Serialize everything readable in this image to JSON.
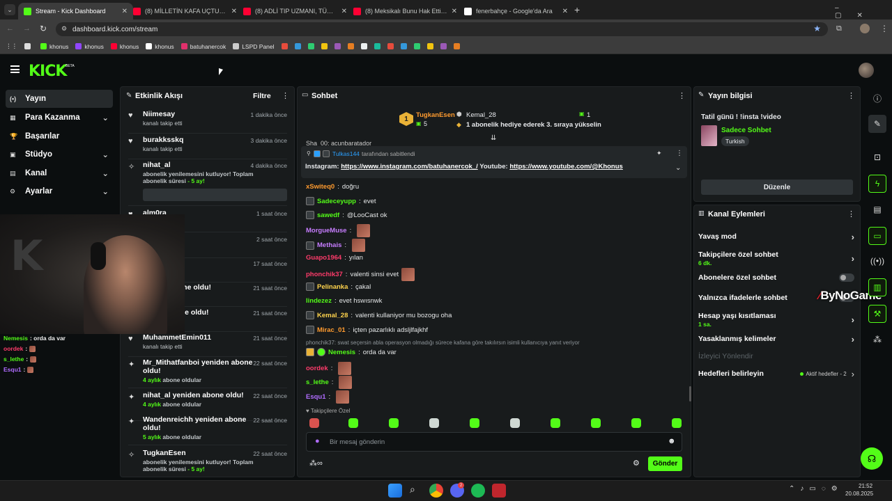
{
  "browser": {
    "tabs": [
      {
        "label": "Stream - Kick Dashboard",
        "color": "#53fc18"
      },
      {
        "label": "(8) MİLLETİN KAFA UÇTU 5Srid…",
        "color": "#ff0033"
      },
      {
        "label": "(8) ADLİ TIP UZMANI, TÜRK DÜ…",
        "color": "#ff0033"
      },
      {
        "label": "(8) Meksikalı Bunu Hak Etti mi?",
        "color": "#ff0033"
      },
      {
        "label": "fenerbahçe - Google'da Ara",
        "color": "#ffffff"
      }
    ],
    "url": "dashboard.kick.com/stream",
    "bookmarks": [
      {
        "label": "",
        "color": "#ddd"
      },
      {
        "label": "khonus",
        "color": "#53fc18"
      },
      {
        "label": "khonus",
        "color": "#9146ff"
      },
      {
        "label": "khonus",
        "color": "#ff0033"
      },
      {
        "label": "khonus",
        "color": "#ffffff"
      },
      {
        "label": "batuhanercok",
        "color": "#e1306c"
      },
      {
        "label": "LSPD Panel",
        "color": "#cccccc"
      }
    ]
  },
  "header": {
    "logo": "KICK",
    "beta": "BETA"
  },
  "nav": [
    {
      "label": "Yayın",
      "icon": "(•)",
      "chev": ""
    },
    {
      "label": "Para Kazanma",
      "icon": "▦",
      "chev": "⌄"
    },
    {
      "label": "Başarılar",
      "icon": "🏆",
      "chev": ""
    },
    {
      "label": "Stüdyo",
      "icon": "▣",
      "chev": "⌄"
    },
    {
      "label": "Kanal",
      "icon": "▤",
      "chev": "⌄"
    },
    {
      "label": "Ayarlar",
      "icon": "⚙",
      "chev": "⌄"
    }
  ],
  "activity": {
    "title": "Etkinlik Akışı",
    "filter": "Filtre",
    "events": [
      {
        "name": "Niimesay",
        "sub": "kanalı takip etti",
        "time": "1 dakika önce",
        "icon": "♥"
      },
      {
        "name": "burakksskq",
        "sub": "kanalı takip etti",
        "time": "3 dakika önce",
        "icon": "♥"
      },
      {
        "name": "nihat_al",
        "sub": "abonelik yenilemesini kutluyor! Toplam abonelik süresi - 5 ay!",
        "time": "4 dakika önce",
        "icon": "✧"
      },
      {
        "name": "alm0ra",
        "sub": "kanalı takip etti",
        "time": "1 saat önce",
        "icon": "♥"
      },
      {
        "name": "",
        "sub": "",
        "time": "2 saat önce",
        "icon": ""
      },
      {
        "name": "",
        "sub": "",
        "time": "17 saat önce",
        "icon": ""
      },
      {
        "name": "…nden abone oldu!",
        "sub": "…lar",
        "time": "21 saat önce",
        "icon": ""
      },
      {
        "name": "…iden abone oldu!",
        "sub": "…ldular",
        "time": "21 saat önce",
        "icon": ""
      },
      {
        "name": "MuhammetEmin011",
        "sub": "kanalı takip etti",
        "time": "21 saat önce",
        "icon": "♥"
      },
      {
        "name": "Mr_Mithatfanboi yeniden abone oldu!",
        "sub": "4 aylık abone oldular",
        "time": "22 saat önce",
        "icon": "✦"
      },
      {
        "name": "nihat_al yeniden abone oldu!",
        "sub": "4 aylık abone oldular",
        "time": "22 saat önce",
        "icon": "✦"
      },
      {
        "name": "Wandenreichh yeniden abone oldu!",
        "sub": "5 aylık abone oldular",
        "time": "22 saat önce",
        "icon": "✦"
      },
      {
        "name": "TugkanEsen",
        "sub": "abonelik yenilemesini kutluyor! Toplam abonelik süresi - 5 ay!",
        "time": "22 saat önce",
        "icon": "✧"
      }
    ]
  },
  "overlay_chat": [
    {
      "user": "Nemesis",
      "msg": ": orda da var",
      "color": "#53fc18"
    },
    {
      "user": "oordek",
      "msg": ":",
      "color": "#ff3b6b"
    },
    {
      "user": "s_lethe",
      "msg": ":",
      "color": "#53fc18"
    },
    {
      "user": "Esqu1",
      "msg": ":",
      "color": "#b06cff"
    }
  ],
  "chat": {
    "title": "Sohbet",
    "leaderboard": {
      "rank": "1",
      "user1": "TugkanEsen",
      "count1": "5",
      "user2": "Kemal_28",
      "count2": "1",
      "gift_msg": "1 abonelik hediye ederek 3. sıraya yükselin"
    },
    "pinned": {
      "by": "Tulkas144",
      "by_suffix": "tarafından sabitlendi",
      "text": "Instagram: ",
      "link1": "https://www.instagram.com/batuhanercok_/",
      "mid": " Youtube: ",
      "link2": "https://www.youtube.com/@Khonus"
    },
    "partial_top": "Sha_00: acunbaratador",
    "messages": [
      {
        "user": "xSwiteq0",
        "color": "#ff9b2f",
        "msg": "doğru",
        "badge": false,
        "emote": false
      },
      {
        "user": "Sadeceyupp",
        "color": "#53fc18",
        "msg": "evet",
        "badge": true,
        "emote": false
      },
      {
        "user": "sawedf",
        "color": "#53fc18",
        "msg": "@LooCast ok",
        "badge": true,
        "emote": false
      },
      {
        "user": "MorgueMuse",
        "color": "#c77dff",
        "msg": "",
        "badge": false,
        "emote": true
      },
      {
        "user": "Methais",
        "color": "#c77dff",
        "msg": "",
        "badge": true,
        "emote": true
      },
      {
        "user": "Guapo1964",
        "color": "#ff3b6b",
        "msg": "yılan",
        "badge": false,
        "emote": false
      },
      {
        "user": "phonchik37",
        "color": "#ff3b6b",
        "msg": "valenti sinsi evet",
        "badge": false,
        "emote": true
      },
      {
        "user": "Pelinanka",
        "color": "#ffd34d",
        "msg": "çakal",
        "badge": true,
        "emote": false
      },
      {
        "user": "lindezez",
        "color": "#53fc18",
        "msg": "evet hswısnwk",
        "badge": false,
        "emote": false
      },
      {
        "user": "Kemal_28",
        "color": "#ffd34d",
        "msg": "valenti kullaniyor mu bozogu oha",
        "badge": true,
        "emote": false
      },
      {
        "user": "Mirac_01",
        "color": "#ff9b2f",
        "msg": "içten pazarlıklı adsljlfajkhf",
        "badge": true,
        "emote": false
      }
    ],
    "reply_context": "phonchik37: swat seçersin abla operasyon olmadığı sürece kafana göre takılırsın isimli kullanıcıya yanıt veriyor",
    "messages2": [
      {
        "user": "Nemesis",
        "color": "#53fc18",
        "msg": "orda da var"
      },
      {
        "user": "oordek",
        "color": "#ff3b6b",
        "msg": ""
      },
      {
        "user": "s_lethe",
        "color": "#53fc18",
        "msg": ""
      },
      {
        "user": "Esqu1",
        "color": "#b06cff",
        "msg": ""
      }
    ],
    "followers_only": "Takipçilere Özel",
    "placeholder": "Bir mesaj gönderin",
    "send": "Gönder"
  },
  "stream_info": {
    "title": "Yayın bilgisi",
    "stream_title": "Tatil günü ! !insta !video",
    "category": "Sadece Sohbet",
    "tag": "Turkish",
    "edit": "Düzenle"
  },
  "channel_actions": {
    "title": "Kanal Eylemleri",
    "rows": [
      {
        "label": "Yavaş mod",
        "sub": "",
        "kind": "chev"
      },
      {
        "label": "Takipçilere özel sohbet",
        "sub": "6 dk.",
        "kind": "chev"
      },
      {
        "label": "Abonelere özel sohbet",
        "sub": "",
        "kind": "toggle"
      },
      {
        "label": "Yalnızca ifadelerle sohbet",
        "sub": "",
        "kind": "toggle"
      },
      {
        "label": "Hesap yaşı kısıtlaması",
        "sub": "1 sa.",
        "kind": "chev"
      },
      {
        "label": "Yasaklanmış kelimeler",
        "sub": "",
        "kind": "chev"
      },
      {
        "label": "İzleyici Yönlendir",
        "sub": "",
        "kind": "disabled"
      },
      {
        "label": "Hedefleri belirleyin",
        "sub": "",
        "kind": "goal",
        "extra": "Aktif hedefler - 2"
      }
    ]
  },
  "watermark": "ByNoGame",
  "taskbar": {
    "time": "21:52",
    "date": "20.08.2025",
    "badge": "2"
  },
  "colors": {
    "accent": "#53fc18",
    "bg": "#0b0e0f",
    "panel": "#181b1c"
  }
}
